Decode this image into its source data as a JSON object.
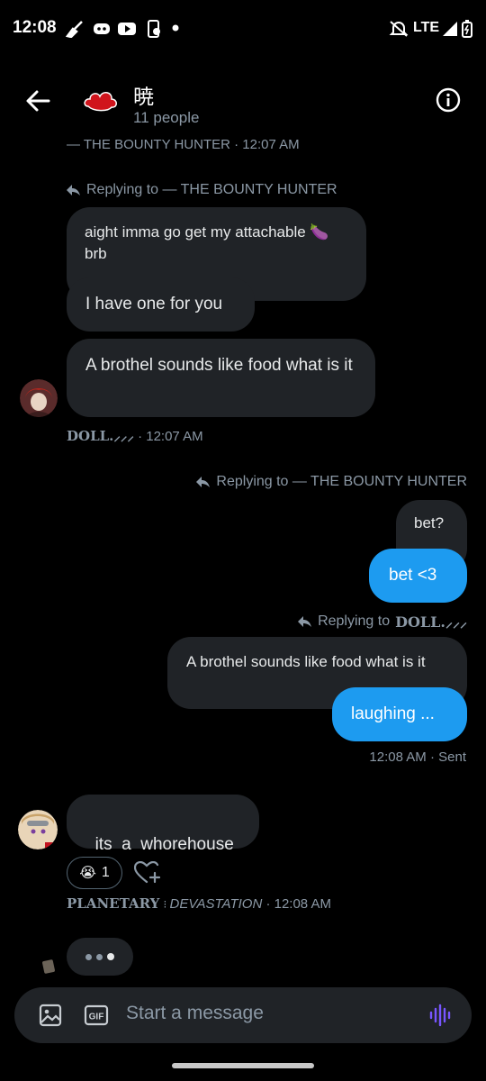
{
  "status_bar": {
    "time": "12:08",
    "network": "LTE"
  },
  "header": {
    "group_name": "暁",
    "member_count": "11 people"
  },
  "messages": {
    "cut_meta": "— THE BOUNTY HUNTER · 12:07 AM",
    "reply1_label": "Replying to — THE BOUNTY HUNTER",
    "reply1_quoted": "aight imma go get my attachable 🍆 brb",
    "reply1_text": "I have one for you",
    "msg_brothel": "A brothel sounds like food what is it",
    "doll_meta_name": "DOLL.⸝⸝⸝",
    "doll_meta_time": "· 12:07 AM",
    "reply2_label": "Replying to — THE BOUNTY HUNTER",
    "out_bet_q": "bet?",
    "out_bet": "bet <3",
    "reply3_label_prefix": "Replying to",
    "reply3_label_name": "DOLL.⸝⸝⸝",
    "reply3_quoted": "A brothel sounds like food what is it",
    "out_laughing": "laughing ...",
    "sent_meta": "12:08 AM · Sent",
    "msg_whorehouse": "its  a  whorehouse",
    "reaction_emoji": "😭",
    "reaction_count": "1",
    "planetary_name_a": "PLANETARY",
    "planetary_name_b": "DEVASTATION",
    "planetary_time": "· 12:08 AM"
  },
  "composer": {
    "placeholder": "Start a message"
  },
  "colors": {
    "accent": "#1d9bf0",
    "bubble": "#202327",
    "muted": "#8b98a5",
    "mic": "#7856ff"
  }
}
